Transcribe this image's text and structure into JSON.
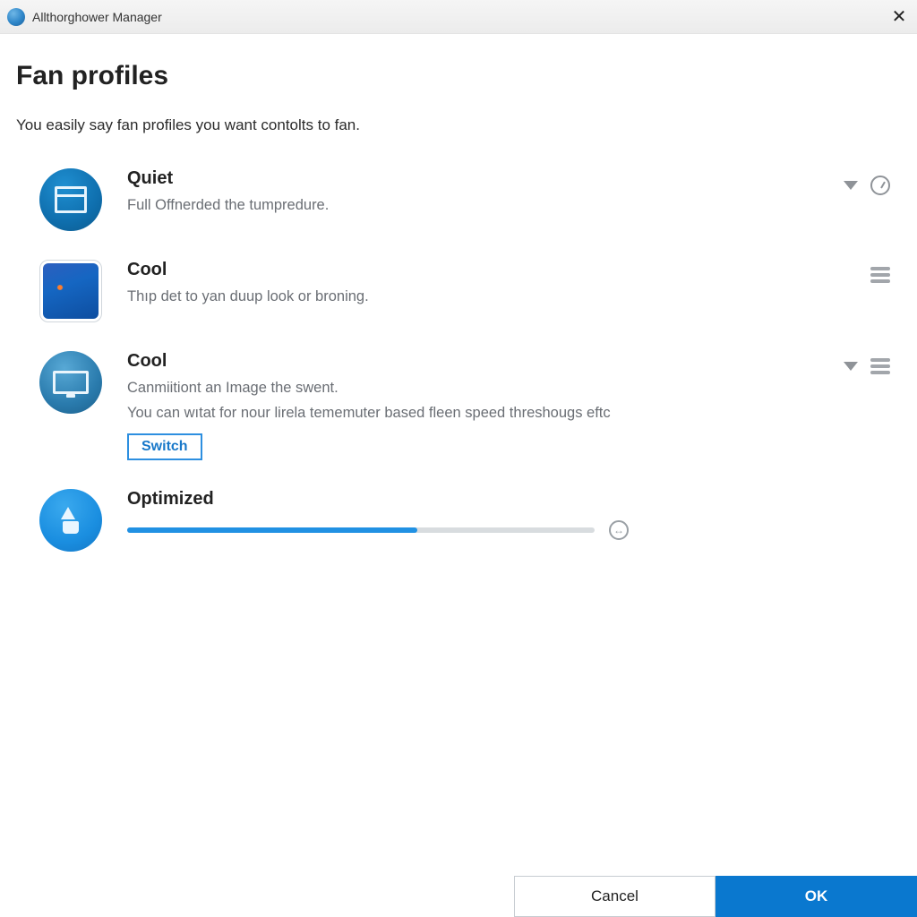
{
  "window": {
    "title": "Allthorghower Manager"
  },
  "page": {
    "heading": "Fan profiles",
    "subtitle": "You easily say fan profiles you want contolts to fan."
  },
  "profiles": [
    {
      "id": "quiet",
      "title": "Quiet",
      "desc1": "Full Offnerded the tumpredure.",
      "icon": "window-icon",
      "actions": {
        "chevron": true,
        "gauge": true,
        "stack": false
      }
    },
    {
      "id": "cool-a",
      "title": "Cool",
      "desc1": "Thıp det to yan duup look or broning.",
      "icon": "wallpaper-thumb",
      "actions": {
        "chevron": false,
        "gauge": false,
        "stack": true
      }
    },
    {
      "id": "cool-b",
      "title": "Cool",
      "desc1": "Canmiitiont an Image the swent.",
      "desc2": "You can wıtat for nour lirela tememuter based fleen speed threshougs eftc",
      "switch_label": "Switch",
      "icon": "monitor-icon",
      "actions": {
        "chevron": true,
        "gauge": false,
        "stack": true
      }
    },
    {
      "id": "optimized",
      "title": "Optimized",
      "icon": "bolt-icon",
      "slider_percent": 62
    }
  ],
  "footer": {
    "cancel": "Cancel",
    "ok": "OK"
  },
  "colors": {
    "accent": "#0a78cf",
    "slider": "#2191e3"
  }
}
